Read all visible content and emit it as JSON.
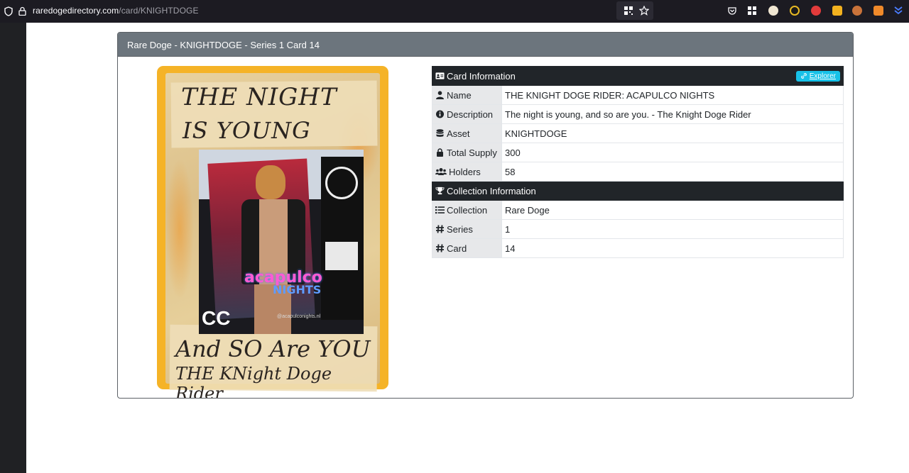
{
  "browser": {
    "url_host": "raredogedirectory.com",
    "url_path": "/card/KNIGHTDOGE"
  },
  "panel": {
    "title": "Rare Doge - KNIGHTDOGE - Series 1 Card 14"
  },
  "card_art": {
    "line1": "THE NIGHT",
    "line2": "IS YOUNG",
    "line3": "And SO Are YOU",
    "line4": "THE KNight Doge Rider",
    "poster_text1": "acapulco",
    "poster_text2": "NIGHTS",
    "poster_text3": "CC",
    "poster_handle": "@acapulconights.nl"
  },
  "card_info": {
    "header": "Card Information",
    "explorer_label": "Explorer",
    "rows": [
      {
        "label": "Name",
        "value": "THE KNIGHT DOGE RIDER: ACAPULCO NIGHTS"
      },
      {
        "label": "Description",
        "value": "The night is young, and so are you. - The Knight Doge Rider"
      },
      {
        "label": "Asset",
        "value": "KNIGHTDOGE"
      },
      {
        "label": "Total Supply",
        "value": "300"
      },
      {
        "label": "Holders",
        "value": "58"
      }
    ]
  },
  "collection_info": {
    "header": "Collection Information",
    "rows": [
      {
        "label": "Collection",
        "value": "Rare Doge"
      },
      {
        "label": "Series",
        "value": "1"
      },
      {
        "label": "Card",
        "value": "14"
      }
    ]
  },
  "colors": {
    "panel_header": "#6c757d",
    "section_header": "#212529",
    "explorer_button": "#17c1e8",
    "card_frame": "#f5b327"
  }
}
